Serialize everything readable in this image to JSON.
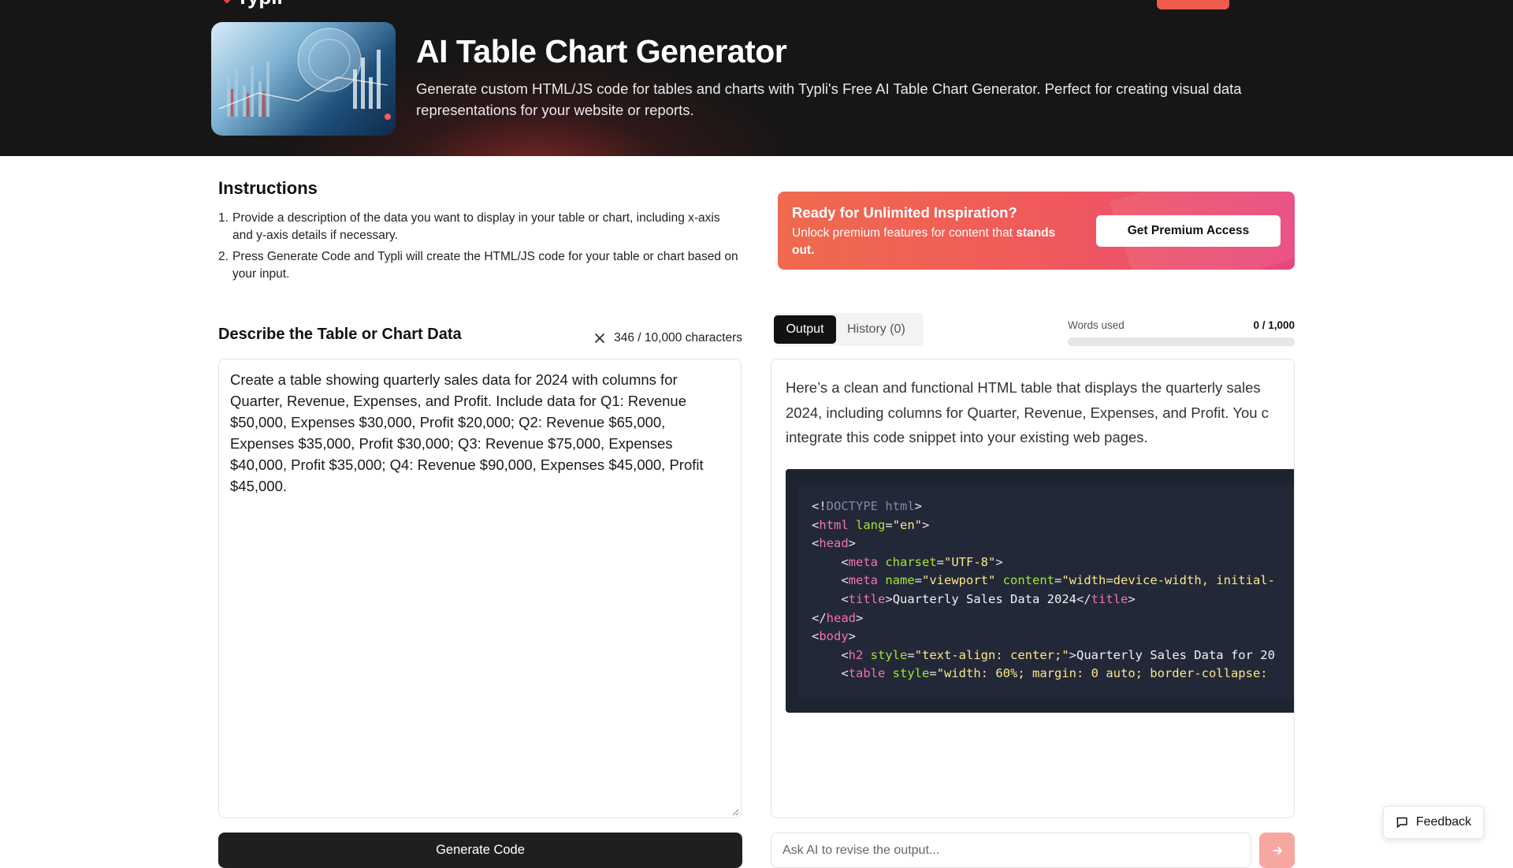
{
  "nav": {
    "logo": "Typli"
  },
  "hero": {
    "title": "AI Table Chart Generator",
    "subtitle": "Generate custom HTML/JS code for tables and charts with Typli's Free AI Table Chart Generator. Perfect for creating visual data representations for your website or reports."
  },
  "instructions": {
    "title": "Instructions",
    "steps": [
      {
        "num": "1.",
        "text": "Provide a description of the data you want to display in your table or chart, including x-axis and y-axis details if necessary."
      },
      {
        "num": "2.",
        "text": "Press Generate Code and Typli will create the HTML/JS code for your table or chart based on your input."
      }
    ]
  },
  "input": {
    "title": "Describe the Table or Chart Data",
    "char_count": "346 / 10,000 characters",
    "value": "Create a table showing quarterly sales data for 2024 with columns for Quarter, Revenue, Expenses, and Profit. Include data for Q1: Revenue $50,000, Expenses $30,000, Profit $20,000; Q2: Revenue $65,000, Expenses $35,000, Profit $30,000; Q3: Revenue $75,000, Expenses $40,000, Profit $35,000; Q4: Revenue $90,000, Expenses $45,000, Profit $45,000.",
    "generate_label": "Generate Code"
  },
  "promo": {
    "title": "Ready for Unlimited Inspiration?",
    "text_line1": "Unlock premium features for content that",
    "text_bold": "stands out.",
    "button_label": "Get Premium Access"
  },
  "tabs": [
    {
      "label": "Output",
      "active": true
    },
    {
      "label": "History (0)",
      "active": false
    }
  ],
  "words": {
    "label": "Words used",
    "value": "0 / 1,000",
    "used_fraction": 0
  },
  "output": {
    "intro_lines": [
      "Here’s a clean and functional HTML table that displays the quarterly sales",
      "2024, including columns for Quarter, Revenue, Expenses, and Profit. You c",
      "integrate this code snippet into your existing web pages."
    ],
    "code": [
      "<!DOCTYPE html>",
      "<html lang=\"en\">",
      "<head>",
      "    <meta charset=\"UTF-8\">",
      "    <meta name=\"viewport\" content=\"width=device-width, initial-",
      "    <title>Quarterly Sales Data 2024</title>",
      "</head>",
      "<body>",
      "    <h2 style=\"text-align: center;\">Quarterly Sales Data for 20",
      "    <table style=\"width: 60%; margin: 0 auto; border-collapse:"
    ]
  },
  "revise": {
    "placeholder": "Ask AI to revise the output..."
  },
  "feedback": {
    "label": "Feedback"
  },
  "colors": {
    "hero_bg": "#161616",
    "accent": "#ef5b4a",
    "promo_start": "#ef6a4e",
    "promo_end": "#e8467c",
    "code_bg": "#1e2330"
  }
}
